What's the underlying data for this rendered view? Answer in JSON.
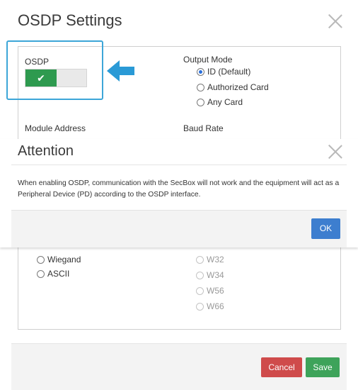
{
  "settings_modal": {
    "title": "OSDP Settings",
    "osdp_label": "OSDP",
    "toggle_check": "✔",
    "output_mode": {
      "label": "Output Mode",
      "options": [
        {
          "label": "ID (Default)",
          "checked": true
        },
        {
          "label": "Authorized Card",
          "checked": false
        },
        {
          "label": "Any Card",
          "checked": false
        }
      ]
    },
    "module_address_label": "Module Address",
    "baud_rate_label": "Baud Rate",
    "format_options": [
      {
        "label": "Wiegand",
        "checked": false
      },
      {
        "label": "ASCII",
        "checked": false
      }
    ],
    "wiegand_options": [
      {
        "label": "W32",
        "checked": false
      },
      {
        "label": "W34",
        "checked": false
      },
      {
        "label": "W56",
        "checked": false
      },
      {
        "label": "W66",
        "checked": false
      }
    ],
    "cancel_label": "Cancel",
    "save_label": "Save"
  },
  "attention_dialog": {
    "title": "Attention",
    "message": "When enabling OSDP, communication with the SecBox will not work and the equipment will act as a Peripheral Device (PD) according to the OSDP interface.",
    "ok_label": "OK"
  },
  "colors": {
    "highlight": "#3da6d8",
    "toggle_on": "#2e9a4f",
    "ok": "#3d7ecf",
    "cancel": "#cf4b4b",
    "save": "#3ea35a"
  }
}
